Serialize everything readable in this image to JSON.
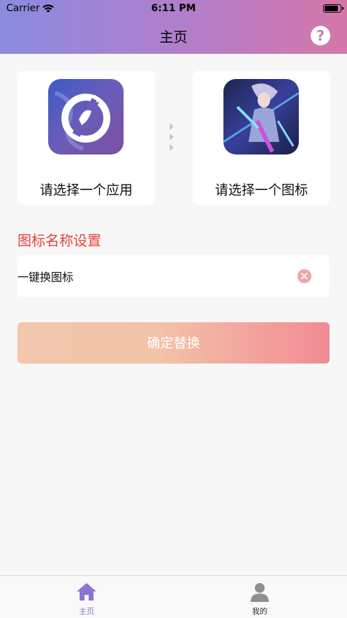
{
  "status_bar": {
    "carrier": "Carrier",
    "time": "6:11 PM"
  },
  "header": {
    "title": "主页",
    "help_icon": "question-circle-icon",
    "help_glyph": "?"
  },
  "cards": {
    "app": {
      "label": "请选择一个应用",
      "image": "app-logo-image"
    },
    "icon": {
      "label": "请选择一个图标",
      "image": "game-character-image"
    }
  },
  "name_setting": {
    "title": "图标名称设置",
    "value": "一键换图标",
    "clear_glyph": "×"
  },
  "confirm_button": {
    "label": "确定替换"
  },
  "tabbar": {
    "items": [
      {
        "label": "主页",
        "icon": "home-icon",
        "active": true
      },
      {
        "label": "我的",
        "icon": "person-icon",
        "active": false
      }
    ]
  },
  "colors": {
    "header_gradient": [
      "#8a8be0",
      "#d577a8"
    ],
    "accent_red": "#e8443c",
    "tab_active": "#8b76d6"
  }
}
